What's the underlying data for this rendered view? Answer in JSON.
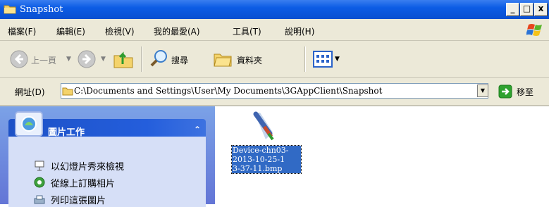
{
  "window": {
    "title": "Snapshot",
    "buttons": {
      "minimize": "_",
      "maximize": "□",
      "close": "x"
    }
  },
  "menu": {
    "items": [
      "檔案(F)",
      "編輯(E)",
      "檢視(V)",
      "我的最愛(A)",
      "工具(T)",
      "說明(H)"
    ]
  },
  "toolbar": {
    "back_label": "上一頁",
    "search_label": "搜尋",
    "folders_label": "資料夾"
  },
  "address": {
    "label": "網址(D)",
    "path": "C:\\Documents and Settings\\User\\My Documents\\3GAppClient\\Snapshot",
    "go_label": "移至"
  },
  "task_panel": {
    "title": "圖片工作",
    "collapse": "≈",
    "links": [
      "以幻燈片秀來檢視",
      "從線上訂購相片",
      "列印這張圖片"
    ]
  },
  "files": [
    {
      "name": "Device-chn03-2013-10-25-13-37-11.bmp",
      "lines": [
        "Device-chn03-",
        "2013-10-25-1",
        "3-37-11.bmp"
      ],
      "icon": "paint-bmp-icon",
      "selected": true
    }
  ],
  "colors": {
    "titlebar": "#0c5ce5",
    "selection": "#316ac5",
    "panel": "#6375d6"
  }
}
